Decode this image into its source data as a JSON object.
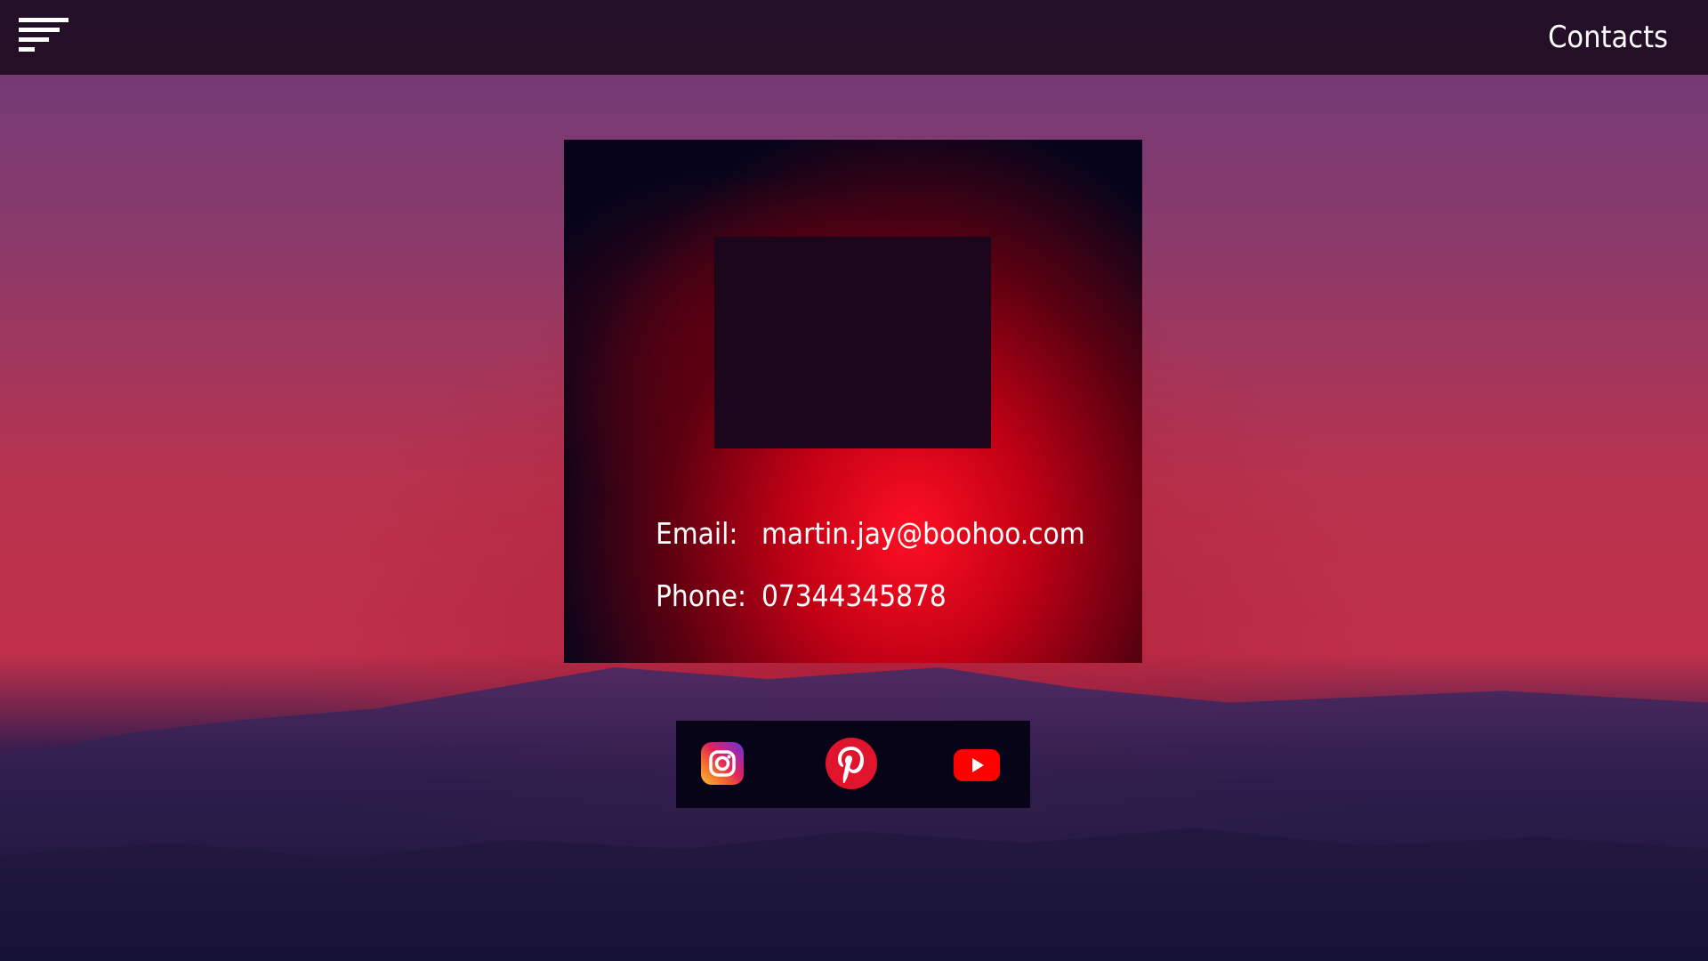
{
  "header": {
    "title": "Contacts",
    "menu_icon": "hamburger-menu-icon"
  },
  "card": {
    "email_label": "Email:",
    "email_value": "martin.jay@boohoo.com",
    "phone_label": "Phone:",
    "phone_value": "07344345878"
  },
  "social": {
    "icons": [
      "instagram-icon",
      "pinterest-icon",
      "youtube-icon"
    ]
  },
  "colors": {
    "accent_red": "#ff0f24",
    "dark_panel": "#07041a",
    "text": "#ffffff"
  }
}
